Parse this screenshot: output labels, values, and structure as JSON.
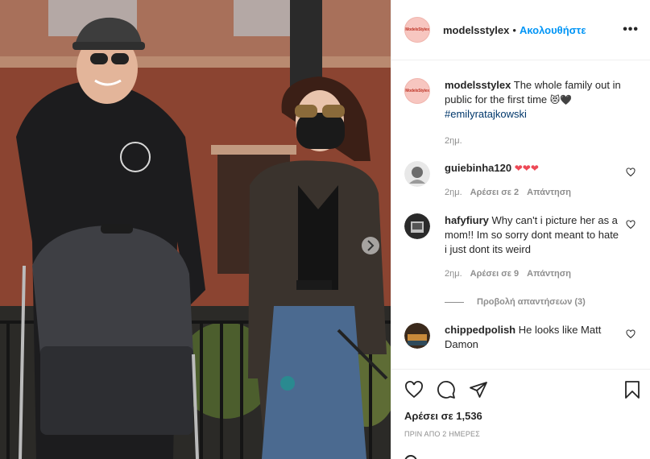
{
  "post": {
    "username": "modelsstylex",
    "avatar_text": "ModelsStylex",
    "follow_label": "Ακολουθήστε",
    "separator": "•",
    "more_label": "•••",
    "caption": {
      "username": "modelsstylex",
      "text": "The whole family out in public for the first time",
      "emojis": "😻🖤",
      "hashtag": "#emilyratajkowski",
      "time": "2ημ."
    },
    "comments": [
      {
        "username": "guiebinha120",
        "text": "",
        "hearts": "❤❤❤",
        "time": "2ημ.",
        "likes": "Αρέσει σε 2",
        "reply": "Απάντηση"
      },
      {
        "username": "hafyfiury",
        "text": "Why can't i picture her as a mom!! Im so sorry dont meant to hate i just dont its weird",
        "time": "2ημ.",
        "likes": "Αρέσει σε 9",
        "reply": "Απάντηση",
        "view_replies": "Προβολή απαντήσεων (3)"
      },
      {
        "username": "chippedpolish",
        "text": "He looks like Matt Damon"
      }
    ],
    "likes_label": "Αρέσει σε 1,536",
    "date_label": "ΠΡΙΝ ΑΠΟ 2 ΗΜΕΡΕΣ",
    "icons": [
      "heart-icon",
      "comment-icon",
      "share-icon",
      "bookmark-icon",
      "more-icon"
    ],
    "colors": {
      "accent": "#0095f6",
      "heart": "#ed4956",
      "text": "#262626",
      "muted": "#8e8e8e"
    }
  }
}
